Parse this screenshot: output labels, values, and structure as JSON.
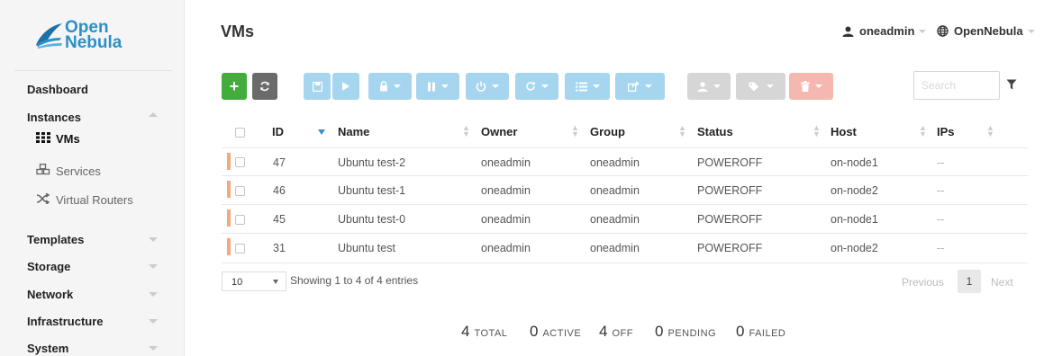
{
  "app": {
    "logo_line1": "Open",
    "logo_line2": "Nebula"
  },
  "sidebar": {
    "items": [
      {
        "label": "Dashboard"
      },
      {
        "label": "Instances"
      },
      {
        "label": "Templates"
      },
      {
        "label": "Storage"
      },
      {
        "label": "Network"
      },
      {
        "label": "Infrastructure"
      },
      {
        "label": "System"
      }
    ],
    "instances_sub": [
      {
        "label": "VMs",
        "icon": "grid-icon"
      },
      {
        "label": "Services",
        "icon": "cubes-icon"
      },
      {
        "label": "Virtual Routers",
        "icon": "random-icon"
      }
    ]
  },
  "header": {
    "title": "VMs",
    "user": "oneadmin",
    "zone": "OpenNebula"
  },
  "toolbar": {
    "search_placeholder": "Search",
    "colors": {
      "create": "#43ac3c",
      "refresh": "#6b6b6b",
      "actions": "#a6d5ef",
      "disabled": "#d6d6d6",
      "delete": "#f4b8b0"
    }
  },
  "table": {
    "columns": [
      "ID",
      "Name",
      "Owner",
      "Group",
      "Status",
      "Host",
      "IPs"
    ],
    "rows": [
      {
        "id": "47",
        "name": "Ubuntu test-2",
        "owner": "oneadmin",
        "group": "oneadmin",
        "status": "POWEROFF",
        "host": "on-node1",
        "ips": "--"
      },
      {
        "id": "46",
        "name": "Ubuntu test-1",
        "owner": "oneadmin",
        "group": "oneadmin",
        "status": "POWEROFF",
        "host": "on-node2",
        "ips": "--"
      },
      {
        "id": "45",
        "name": "Ubuntu test-0",
        "owner": "oneadmin",
        "group": "oneadmin",
        "status": "POWEROFF",
        "host": "on-node1",
        "ips": "--"
      },
      {
        "id": "31",
        "name": "Ubuntu test",
        "owner": "oneadmin",
        "group": "oneadmin",
        "status": "POWEROFF",
        "host": "on-node2",
        "ips": "--"
      }
    ],
    "state_color": "#f5a880"
  },
  "footer": {
    "page_length": "10",
    "info": "Showing 1 to 4 of 4 entries",
    "prev": "Previous",
    "current_page": "1",
    "next": "Next"
  },
  "stats": [
    {
      "count": "4",
      "label": "TOTAL"
    },
    {
      "count": "0",
      "label": "ACTIVE"
    },
    {
      "count": "4",
      "label": "OFF"
    },
    {
      "count": "0",
      "label": "PENDING"
    },
    {
      "count": "0",
      "label": "FAILED"
    }
  ]
}
